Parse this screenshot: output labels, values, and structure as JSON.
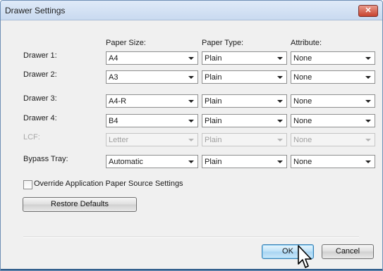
{
  "window": {
    "title": "Drawer Settings",
    "close_glyph": "✕"
  },
  "headers": {
    "paper_size": "Paper Size:",
    "paper_type": "Paper Type:",
    "attribute": "Attribute:"
  },
  "rows": [
    {
      "label": "Drawer 1:",
      "size": "A4",
      "type": "Plain",
      "attribute": "None",
      "enabled": true
    },
    {
      "label": "Drawer 2:",
      "size": "A3",
      "type": "Plain",
      "attribute": "None",
      "enabled": true
    },
    {
      "label": "Drawer 3:",
      "size": "A4-R",
      "type": "Plain",
      "attribute": "None",
      "enabled": true
    },
    {
      "label": "Drawer 4:",
      "size": "B4",
      "type": "Plain",
      "attribute": "None",
      "enabled": true
    },
    {
      "label": "LCF:",
      "size": "Letter",
      "type": "Plain",
      "attribute": "None",
      "enabled": false
    },
    {
      "label": "Bypass Tray:",
      "size": "Automatic",
      "type": "Plain",
      "attribute": "None",
      "enabled": true
    }
  ],
  "override_checkbox": {
    "label": "Override Application Paper Source Settings",
    "checked": false
  },
  "buttons": {
    "restore": "Restore Defaults",
    "ok": "OK",
    "cancel": "Cancel"
  },
  "icons": {
    "close": "close-icon",
    "dropdown": "chevron-down-icon",
    "cursor": "mouse-pointer-icon"
  }
}
